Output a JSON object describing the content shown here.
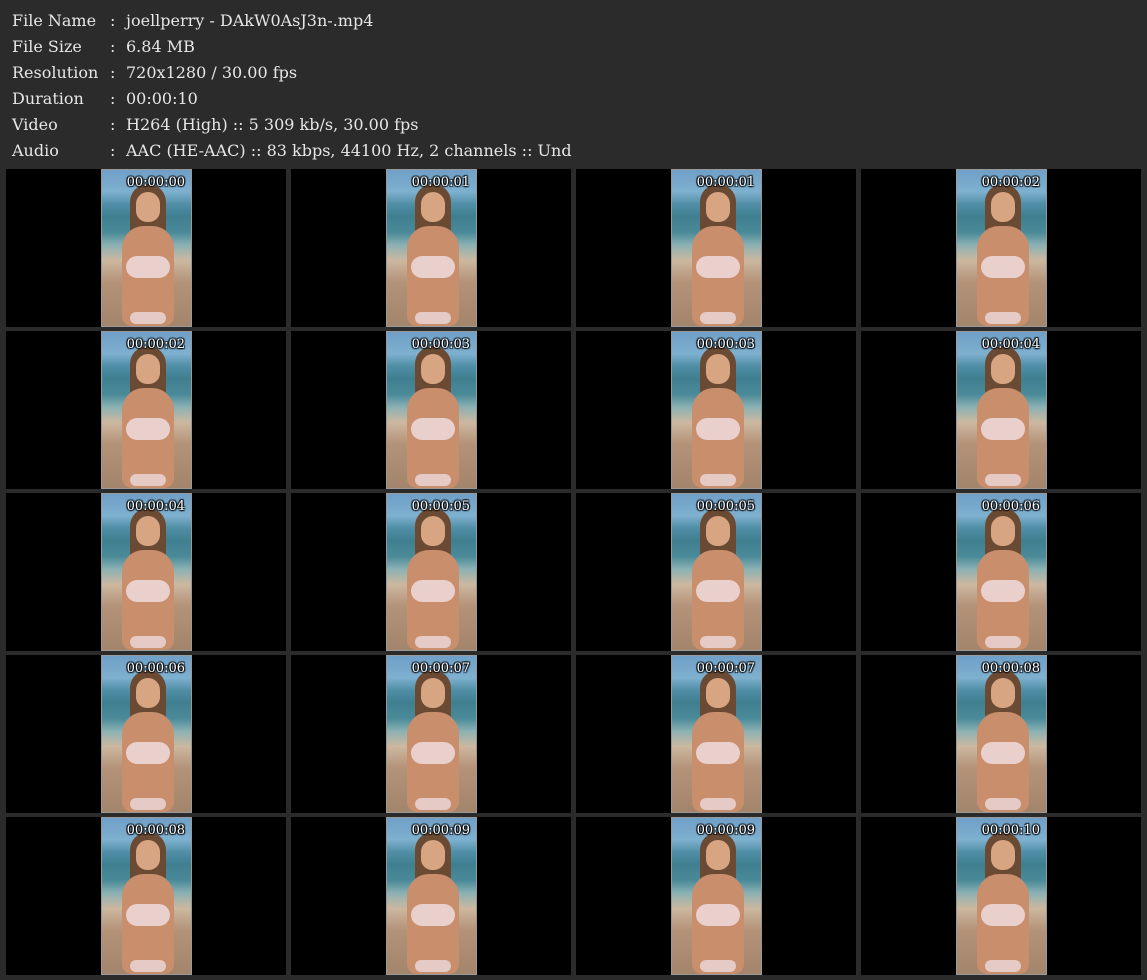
{
  "info": [
    {
      "label": "File Name",
      "sep": ":",
      "value": "joellperry - DAkW0AsJ3n-.mp4"
    },
    {
      "label": "File Size",
      "sep": ":",
      "value": "6.84 MB"
    },
    {
      "label": "Resolution",
      "sep": ":",
      "value": "720x1280 / 30.00 fps"
    },
    {
      "label": "Duration",
      "sep": ":",
      "value": "00:00:10"
    },
    {
      "label": "Video",
      "sep": ":",
      "value": "H264 (High) :: 5 309 kb/s, 30.00 fps"
    },
    {
      "label": "Audio",
      "sep": ":",
      "value": "AAC (HE-AAC) :: 83 kbps, 44100 Hz, 2 channels :: Und"
    }
  ],
  "thumbnails": [
    {
      "timestamp": "00:00:00"
    },
    {
      "timestamp": "00:00:01"
    },
    {
      "timestamp": "00:00:01"
    },
    {
      "timestamp": "00:00:02"
    },
    {
      "timestamp": "00:00:02"
    },
    {
      "timestamp": "00:00:03"
    },
    {
      "timestamp": "00:00:03"
    },
    {
      "timestamp": "00:00:04"
    },
    {
      "timestamp": "00:00:04"
    },
    {
      "timestamp": "00:00:05"
    },
    {
      "timestamp": "00:00:05"
    },
    {
      "timestamp": "00:00:06"
    },
    {
      "timestamp": "00:00:06"
    },
    {
      "timestamp": "00:00:07"
    },
    {
      "timestamp": "00:00:07"
    },
    {
      "timestamp": "00:00:08"
    },
    {
      "timestamp": "00:00:08"
    },
    {
      "timestamp": "00:00:09"
    },
    {
      "timestamp": "00:00:09"
    },
    {
      "timestamp": "00:00:10"
    }
  ],
  "colors": {
    "background": "#2b2b2b",
    "cell": "#000000",
    "text": "#e6e6e6"
  }
}
